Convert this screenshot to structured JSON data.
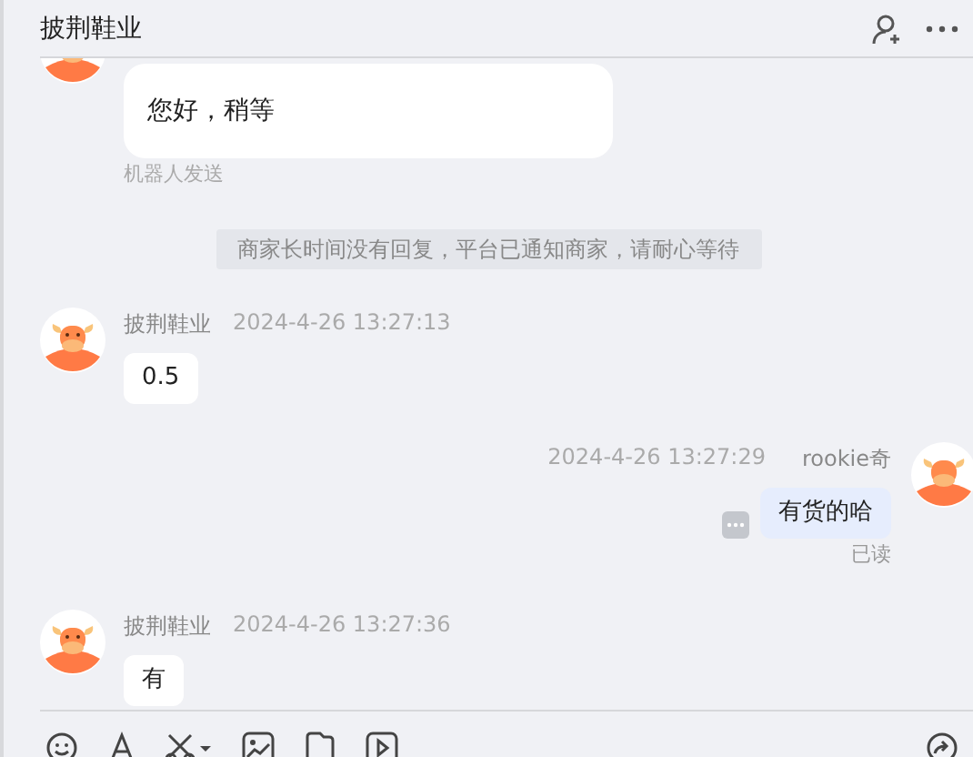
{
  "window": {
    "title": "披荆鞋业"
  },
  "messages": [
    {
      "kind": "incoming",
      "text": "您好，稍等",
      "note": "机器人发送"
    },
    {
      "kind": "system",
      "text": "商家长时间没有回复，平台已通知商家，请耐心等待"
    },
    {
      "kind": "incoming",
      "sender": "披荆鞋业",
      "time": "2024-4-26 13:27:13",
      "text": "0.5"
    },
    {
      "kind": "outgoing",
      "sender": "rookie奇",
      "time": "2024-4-26 13:27:29",
      "text": "有货的哈",
      "status": "已读"
    },
    {
      "kind": "incoming",
      "sender": "披荆鞋业",
      "time": "2024-4-26 13:27:36",
      "text": "有"
    }
  ]
}
